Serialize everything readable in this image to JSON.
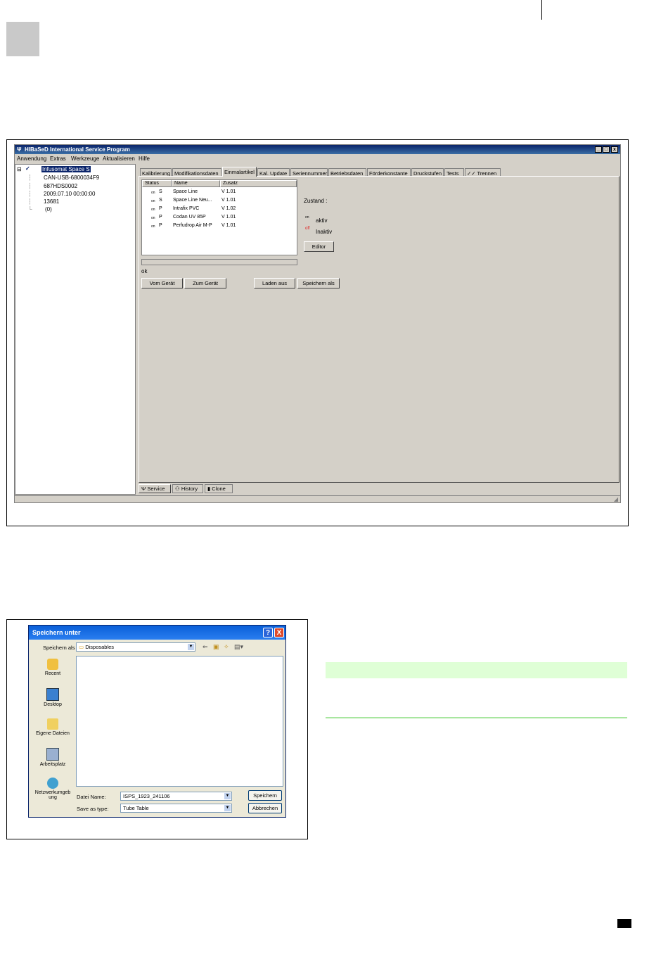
{
  "window": {
    "title": "HIBaSeD  International  Service Program",
    "controls": [
      "_",
      "□",
      "x"
    ]
  },
  "menu": [
    "Anwendung",
    "Extras",
    "Werkzeuge",
    "Aktualisieren",
    "Hilfe"
  ],
  "tree": {
    "root": "Infusomat Space S",
    "children": [
      "CAN-USB-6800034F9",
      "687HDS0002",
      "2009.07.10 00:00:00",
      "13681",
      "(0)"
    ]
  },
  "tabs": [
    "Kalibrierung",
    "Modifikationsdaten",
    "Einmalartikel",
    "Kal. Update",
    "Seriennummer",
    "Betriebsdaten",
    "Förderkonstante",
    "Druckstufen",
    "Tests",
    "✓✓ Trennen"
  ],
  "active_tab": "Einmalartikel",
  "listview": {
    "headers": [
      "Status",
      "Name",
      "Zusatz"
    ],
    "rows": [
      {
        "onoff": "on",
        "type": "S",
        "name": "Space Line",
        "zusatz": "V 1.01"
      },
      {
        "onoff": "on",
        "type": "S",
        "name": "Space Line Neu...",
        "zusatz": "V 1.01"
      },
      {
        "onoff": "on",
        "type": "P",
        "name": "Intrafix PVC",
        "zusatz": "V 1.02"
      },
      {
        "onoff": "on",
        "type": "P",
        "name": "Codan UV 85P",
        "zusatz": "V 1.01"
      },
      {
        "onoff": "on",
        "type": "P",
        "name": "Perfudrop Air M-P",
        "zusatz": "V 1.01"
      }
    ]
  },
  "status_ok": "ok",
  "zustand": {
    "label": "Zustand :",
    "on_tag": "on",
    "on_label": "aktiv",
    "off_tag": "off",
    "off_label": "Inaktiv",
    "off_color": "#e02020",
    "editor_button": "Editor"
  },
  "buttons": {
    "vom_geraet": "Vom Gerät",
    "zum_geraet": "Zum Gerät",
    "laden_aus": "Laden aus",
    "speichern_als": "Speichern als"
  },
  "bottom_tabs": [
    "Service",
    "History",
    "Clone"
  ],
  "dialog": {
    "title": "Speichern unter",
    "help": "?",
    "close": "X",
    "speichern_in_label": "Speichern als",
    "folder": "Disposables",
    "places": [
      "Recent",
      "Desktop",
      "Eigene Dateien",
      "Arbeitsplatz",
      "Netzwerkumgeb ung"
    ],
    "filename_label": "Datei Name:",
    "filename_value": "ISPS_1923_241106",
    "filetype_label": "Save as type:",
    "filetype_value": "Tube Table",
    "save_button": "Speichern",
    "cancel_button": "Abbrechen"
  }
}
